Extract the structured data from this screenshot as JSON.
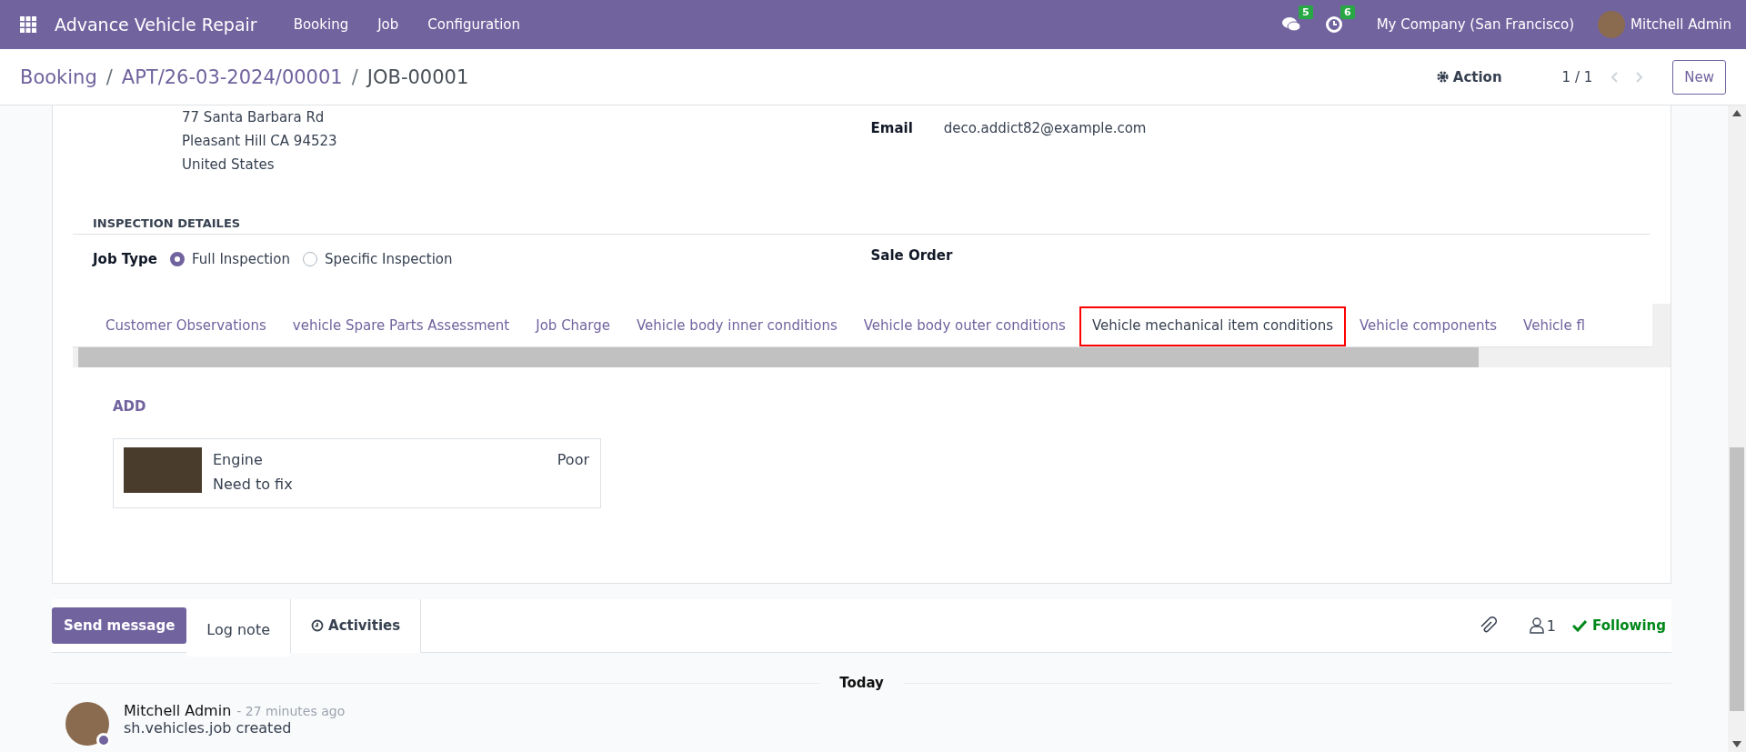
{
  "navbar": {
    "app_name": "Advance Vehicle Repair",
    "menu": [
      "Booking",
      "Job",
      "Configuration"
    ],
    "messages_count": "5",
    "activities_count": "6",
    "company": "My Company (San Francisco)",
    "user": "Mitchell Admin"
  },
  "breadcrumb": {
    "separator": "/",
    "items": [
      "Booking",
      "APT/26-03-2024/00001",
      "JOB-00001"
    ]
  },
  "control_panel": {
    "action": "Action",
    "pager": "1 / 1",
    "new_button": "New"
  },
  "customer": {
    "address_lines": [
      "77 Santa Barbara Rd",
      "Pleasant Hill CA 94523",
      "United States"
    ],
    "email_label": "Email",
    "email": "deco.addict82@example.com"
  },
  "inspection": {
    "section_title": "INSPECTION DETAILES",
    "job_type_label": "Job Type",
    "job_type_options": [
      {
        "label": "Full Inspection",
        "selected": true
      },
      {
        "label": "Specific Inspection",
        "selected": false
      }
    ],
    "sale_order_label": "Sale Order"
  },
  "tabs": [
    {
      "label": "Customer Observations",
      "selected": false
    },
    {
      "label": "vehicle Spare Parts Assessment",
      "selected": false
    },
    {
      "label": "Job Charge",
      "selected": false
    },
    {
      "label": "Vehicle body inner conditions",
      "selected": false
    },
    {
      "label": "Vehicle body outer conditions",
      "selected": false
    },
    {
      "label": "Vehicle mechanical item conditions",
      "selected": true
    },
    {
      "label": "Vehicle components",
      "selected": false
    },
    {
      "label": "Vehicle fl",
      "selected": false
    }
  ],
  "tab_content": {
    "add_button": "ADD",
    "items": [
      {
        "name": "Engine",
        "note": "Need to fix",
        "condition": "Poor"
      }
    ]
  },
  "chatter": {
    "send_message": "Send message",
    "log_note": "Log note",
    "activities": "Activities",
    "followers_count": "1",
    "following": "Following",
    "date_separator": "Today",
    "messages": [
      {
        "author": "Mitchell Admin",
        "time": "- 27 minutes ago",
        "body": "sh.vehicles.job created"
      }
    ]
  }
}
